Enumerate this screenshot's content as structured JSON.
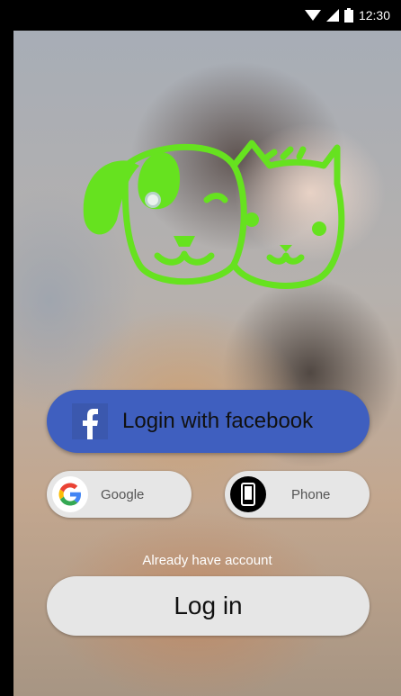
{
  "status_bar": {
    "time": "12:30"
  },
  "login": {
    "facebook_label": "Login with facebook",
    "google_label": "Google",
    "phone_label": "Phone",
    "already_text": "Already have account",
    "login_label": "Log in"
  },
  "colors": {
    "logo_green": "#66e21f",
    "facebook_blue": "#3f5fbf",
    "pill_grey": "#e6e6e6"
  },
  "icons": [
    "wifi-icon",
    "signal-icon",
    "battery-icon",
    "pet-logo-icon",
    "facebook-icon",
    "google-icon",
    "phone-icon"
  ]
}
